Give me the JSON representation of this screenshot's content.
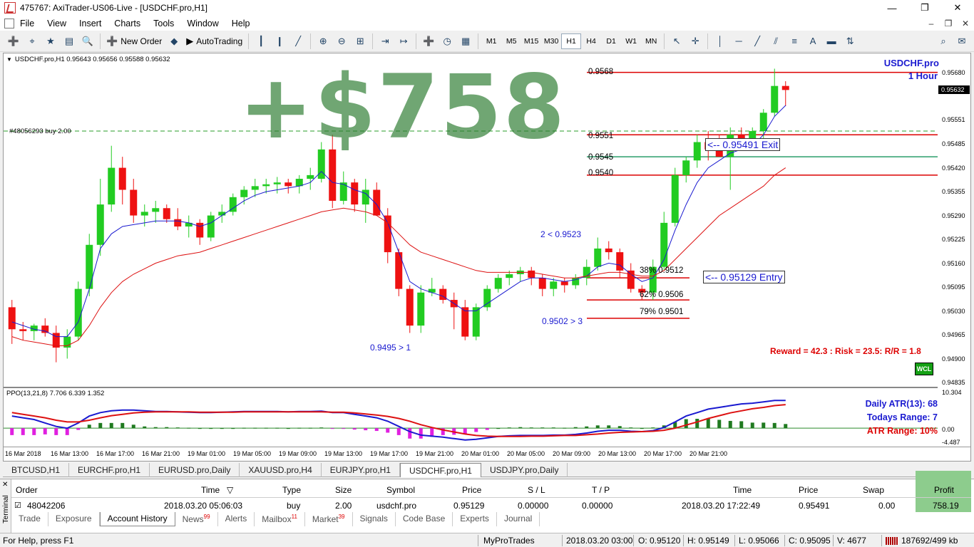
{
  "window": {
    "title": "475767: AxiTrader-US06-Live - [USDCHF.pro,H1]"
  },
  "menu": [
    "File",
    "View",
    "Insert",
    "Charts",
    "Tools",
    "Window",
    "Help"
  ],
  "toolbar": {
    "new_order": "New Order",
    "autotrading": "AutoTrading",
    "timeframes": [
      "M1",
      "M5",
      "M15",
      "M30",
      "H1",
      "H4",
      "D1",
      "W1",
      "MN"
    ],
    "active_timeframe": "H1"
  },
  "chart": {
    "header": "USDCHF.pro,H1  0.95643 0.95656 0.95588 0.95632",
    "order_line_label": "#48056293 buy 2.00",
    "pair": "USDCHF.pro",
    "timeframe_label": "1 Hour",
    "profit_overlay": "+$758",
    "price_ticks": [
      "0.95680",
      "0.95551",
      "0.95485",
      "0.95420",
      "0.95355",
      "0.95290",
      "0.95225",
      "0.95160",
      "0.95095",
      "0.95030",
      "0.94965",
      "0.94900",
      "0.94835"
    ],
    "current_price": "0.95632",
    "level_labels": {
      "l1": "0.9568",
      "l2": "0.9551",
      "l3": "0.9545",
      "l4": "0.9540",
      "fib38": "38% 0.9512",
      "fib62": "62% 0.9506",
      "fib79": "79% 0.9501"
    },
    "exit_label": "<-- 0.95491 Exit",
    "entry_label": "<-- 0.95129 Entry",
    "swing_labels": {
      "a": "2 < 0.9523",
      "b": "0.9502 > 3",
      "c": "0.9495 > 1"
    },
    "reward_risk": "Reward = 42.3 : Risk = 23.5: R/R = 1.8",
    "wcl_badge": "WCL",
    "indicator_header": "PPO(13,21,8) 7.706 6.339 1.352",
    "indicator_ticks": [
      "10.304",
      "0.00",
      "-4.487"
    ],
    "atr_daily": "Daily ATR(13): 68",
    "todays_range": "Todays Range: 7",
    "atr_range": "ATR Range: 10%",
    "time_ticks": [
      "16 Mar 2018",
      "16 Mar 13:00",
      "16 Mar 17:00",
      "16 Mar 21:00",
      "19 Mar 01:00",
      "19 Mar 05:00",
      "19 Mar 09:00",
      "19 Mar 13:00",
      "19 Mar 17:00",
      "19 Mar 21:00",
      "20 Mar 01:00",
      "20 Mar 05:00",
      "20 Mar 09:00",
      "20 Mar 13:00",
      "20 Mar 17:00",
      "20 Mar 21:00"
    ],
    "colors": {
      "bull": "#22cc22",
      "bear": "#ee1111",
      "fast_ma": "#1a1ad0",
      "slow_ma": "#dd1111"
    }
  },
  "chart_data": {
    "type": "candlestick",
    "symbol": "USDCHF.pro",
    "timeframe": "H1",
    "ylim": [
      0.94835,
      0.9572
    ],
    "candles": [
      [
        0.9504,
        0.9506,
        0.9494,
        0.9498
      ],
      [
        0.9498,
        0.95,
        0.9495,
        0.94975
      ],
      [
        0.94975,
        0.94995,
        0.9495,
        0.9499
      ],
      [
        0.9499,
        0.9501,
        0.9496,
        0.9497
      ],
      [
        0.9497,
        0.9499,
        0.9489,
        0.9493
      ],
      [
        0.9493,
        0.9498,
        0.949,
        0.9496
      ],
      [
        0.9496,
        0.9511,
        0.9495,
        0.9509
      ],
      [
        0.9509,
        0.9524,
        0.9507,
        0.9521
      ],
      [
        0.9521,
        0.9539,
        0.9518,
        0.9532
      ],
      [
        0.9532,
        0.9548,
        0.953,
        0.9542
      ],
      [
        0.9542,
        0.9545,
        0.9532,
        0.9536
      ],
      [
        0.9536,
        0.9539,
        0.9527,
        0.9529
      ],
      [
        0.9529,
        0.9532,
        0.9526,
        0.953
      ],
      [
        0.953,
        0.9533,
        0.9527,
        0.9531
      ],
      [
        0.9531,
        0.9532,
        0.9527,
        0.9528
      ],
      [
        0.9528,
        0.9531,
        0.9525,
        0.9526
      ],
      [
        0.9526,
        0.9529,
        0.9523,
        0.9527
      ],
      [
        0.9527,
        0.9528,
        0.9521,
        0.9523
      ],
      [
        0.9523,
        0.953,
        0.9522,
        0.9529
      ],
      [
        0.9529,
        0.9532,
        0.9527,
        0.953
      ],
      [
        0.953,
        0.9535,
        0.9529,
        0.9534
      ],
      [
        0.9534,
        0.9537,
        0.9532,
        0.9536
      ],
      [
        0.9536,
        0.9539,
        0.9534,
        0.9537
      ],
      [
        0.9537,
        0.9539,
        0.9535,
        0.95375
      ],
      [
        0.95375,
        0.95395,
        0.9535,
        0.9538
      ],
      [
        0.9538,
        0.9539,
        0.9535,
        0.9537
      ],
      [
        0.9537,
        0.954,
        0.9535,
        0.9539
      ],
      [
        0.9539,
        0.9542,
        0.9536,
        0.954
      ],
      [
        0.9539,
        0.9549,
        0.9538,
        0.9547
      ],
      [
        0.9547,
        0.9551,
        0.9531,
        0.9533
      ],
      [
        0.9533,
        0.9541,
        0.9532,
        0.9538
      ],
      [
        0.9538,
        0.9539,
        0.953,
        0.9532
      ],
      [
        0.9532,
        0.9539,
        0.9527,
        0.9536
      ],
      [
        0.9536,
        0.9538,
        0.9529,
        0.9529
      ],
      [
        0.9529,
        0.9531,
        0.9516,
        0.9519
      ],
      [
        0.9519,
        0.952,
        0.9507,
        0.9509
      ],
      [
        0.9509,
        0.951,
        0.9497,
        0.9499
      ],
      [
        0.9499,
        0.951,
        0.9497,
        0.9508
      ],
      [
        0.9508,
        0.9512,
        0.9507,
        0.9509
      ],
      [
        0.9509,
        0.951,
        0.9505,
        0.9506
      ],
      [
        0.9506,
        0.9508,
        0.9498,
        0.9504
      ],
      [
        0.9504,
        0.9506,
        0.9495,
        0.9496
      ],
      [
        0.9496,
        0.9505,
        0.9495,
        0.9504
      ],
      [
        0.9504,
        0.951,
        0.9503,
        0.9509
      ],
      [
        0.9509,
        0.9513,
        0.9508,
        0.9512
      ],
      [
        0.9512,
        0.9514,
        0.951,
        0.9513
      ],
      [
        0.9513,
        0.9515,
        0.9511,
        0.9514
      ],
      [
        0.9514,
        0.9515,
        0.951,
        0.9512
      ],
      [
        0.9512,
        0.9513,
        0.9507,
        0.9509
      ],
      [
        0.9509,
        0.9512,
        0.9507,
        0.9511
      ],
      [
        0.9511,
        0.9512,
        0.9508,
        0.951
      ],
      [
        0.951,
        0.9513,
        0.9509,
        0.9512
      ],
      [
        0.9512,
        0.9517,
        0.951,
        0.9515
      ],
      [
        0.9515,
        0.9523,
        0.9514,
        0.952
      ],
      [
        0.952,
        0.9522,
        0.9517,
        0.9519
      ],
      [
        0.9519,
        0.952,
        0.9512,
        0.9514
      ],
      [
        0.9514,
        0.9516,
        0.9508,
        0.9509
      ],
      [
        0.9509,
        0.951,
        0.9506,
        0.9508
      ],
      [
        0.9508,
        0.9517,
        0.9506,
        0.9515
      ],
      [
        0.9515,
        0.953,
        0.9514,
        0.9527
      ],
      [
        0.9527,
        0.9542,
        0.9526,
        0.954
      ],
      [
        0.954,
        0.9545,
        0.9538,
        0.9544
      ],
      [
        0.9544,
        0.9551,
        0.9542,
        0.9549
      ],
      [
        0.9549,
        0.9552,
        0.9544,
        0.9547
      ],
      [
        0.9547,
        0.9551,
        0.9546,
        0.9545
      ],
      [
        0.9545,
        0.9553,
        0.9536,
        0.9551
      ],
      [
        0.9551,
        0.9553,
        0.9547,
        0.9548
      ],
      [
        0.9548,
        0.9553,
        0.9547,
        0.9552
      ],
      [
        0.9552,
        0.9558,
        0.955,
        0.9557
      ],
      [
        0.9557,
        0.9569,
        0.9556,
        0.95643
      ],
      [
        0.95643,
        0.95656,
        0.95588,
        0.95632
      ]
    ],
    "series": [
      {
        "name": "fast MA",
        "values": [
          0.95,
          0.9499,
          0.9498,
          0.94975,
          0.9496,
          0.9496,
          0.95,
          0.9509,
          0.952,
          0.9524,
          0.9526,
          0.95265,
          0.9527,
          0.95275,
          0.95275,
          0.95275,
          0.9527,
          0.9526,
          0.9527,
          0.9529,
          0.9531,
          0.9533,
          0.95345,
          0.95355,
          0.9536,
          0.95365,
          0.9537,
          0.9538,
          0.9541,
          0.9538,
          0.95375,
          0.9536,
          0.9535,
          0.9532,
          0.9527,
          0.9519,
          0.9511,
          0.9509,
          0.9508,
          0.9507,
          0.9505,
          0.9503,
          0.9503,
          0.9505,
          0.9507,
          0.9509,
          0.9511,
          0.9512,
          0.9512,
          0.95115,
          0.9511,
          0.95115,
          0.95125,
          0.9515,
          0.9516,
          0.95155,
          0.9513,
          0.9511,
          0.9512,
          0.9517,
          0.9525,
          0.9532,
          0.9538,
          0.9542,
          0.9544,
          0.9546,
          0.9547,
          0.9548,
          0.9551,
          0.9556,
          0.9559
        ]
      },
      {
        "name": "slow MA",
        "values": [
          0.9496,
          0.9495,
          0.94945,
          0.9494,
          0.94935,
          0.94935,
          0.9495,
          0.9499,
          0.9504,
          0.9508,
          0.9511,
          0.9513,
          0.95145,
          0.9516,
          0.9517,
          0.9518,
          0.95185,
          0.9519,
          0.952,
          0.9521,
          0.9522,
          0.9523,
          0.9524,
          0.9525,
          0.9526,
          0.9527,
          0.9528,
          0.9529,
          0.953,
          0.95305,
          0.9531,
          0.95305,
          0.953,
          0.9529,
          0.9527,
          0.9524,
          0.9521,
          0.9519,
          0.9518,
          0.9517,
          0.9516,
          0.9515,
          0.9514,
          0.95135,
          0.95135,
          0.95135,
          0.95135,
          0.95135,
          0.9513,
          0.95125,
          0.9512,
          0.9512,
          0.95125,
          0.9513,
          0.95135,
          0.95135,
          0.9513,
          0.95125,
          0.95125,
          0.9514,
          0.9517,
          0.952,
          0.9523,
          0.9526,
          0.9529,
          0.9531,
          0.9533,
          0.9535,
          0.9537,
          0.954,
          0.9542
        ]
      }
    ],
    "levels": {
      "l1": 0.9568,
      "l2": 0.9551,
      "l3": 0.9545,
      "l4": 0.954,
      "fib38": 0.9512,
      "fib62": 0.9506,
      "fib79": 0.9501,
      "order": 0.9552
    },
    "indicator": {
      "ylim": [
        -4.487,
        10.304
      ],
      "ppo": [
        3.5,
        3.0,
        2.5,
        1.5,
        0.5,
        0.0,
        1.5,
        3.5,
        4.5,
        5.0,
        5.2,
        5.2,
        5.0,
        4.8,
        4.8,
        4.7,
        4.6,
        4.5,
        4.5,
        4.6,
        4.7,
        4.8,
        4.8,
        4.8,
        4.8,
        4.7,
        4.8,
        4.8,
        4.9,
        4.5,
        4.5,
        4.0,
        3.5,
        3.0,
        2.0,
        0.5,
        -1.0,
        -2.0,
        -2.3,
        -2.6,
        -3.0,
        -3.4,
        -3.2,
        -2.8,
        -2.4,
        -2.2,
        -2.1,
        -2.1,
        -2.1,
        -2.0,
        -2.0,
        -1.8,
        -1.4,
        -0.9,
        -0.6,
        -0.6,
        -0.9,
        -1.0,
        -0.7,
        0.2,
        1.8,
        3.5,
        4.5,
        5.5,
        6.0,
        6.5,
        7.0,
        7.2,
        7.6,
        8.0,
        8.0
      ],
      "signal": [
        4.5,
        4.0,
        3.5,
        3.0,
        2.3,
        1.8,
        1.8,
        2.3,
        3.0,
        3.6,
        4.0,
        4.4,
        4.6,
        4.7,
        4.7,
        4.7,
        4.7,
        4.6,
        4.6,
        4.6,
        4.6,
        4.7,
        4.7,
        4.7,
        4.7,
        4.7,
        4.7,
        4.7,
        4.7,
        4.6,
        4.6,
        4.4,
        4.1,
        3.8,
        3.4,
        2.8,
        2.0,
        1.0,
        0.2,
        -0.5,
        -1.1,
        -1.7,
        -2.1,
        -2.3,
        -2.4,
        -2.4,
        -2.4,
        -2.3,
        -2.3,
        -2.2,
        -2.1,
        -2.1,
        -1.9,
        -1.7,
        -1.4,
        -1.2,
        -1.1,
        -1.0,
        -0.9,
        -0.6,
        0.0,
        0.9,
        1.8,
        2.8,
        3.6,
        4.4,
        5.0,
        5.6,
        6.0,
        6.5,
        6.8
      ],
      "histogram": [
        -2.0,
        -2.0,
        -2.0,
        -1.8,
        -2.0,
        -2.0,
        -0.5,
        1.0,
        1.5,
        1.5,
        1.5,
        1.0,
        0.5,
        0.3,
        0.3,
        0.2,
        0.1,
        0.0,
        0.0,
        0.0,
        0.0,
        0.1,
        0.1,
        0.1,
        0.1,
        0.0,
        0.1,
        0.1,
        0.2,
        -0.1,
        -0.1,
        -0.4,
        -0.6,
        -0.8,
        -1.3,
        -2.0,
        -3.0,
        -3.0,
        -2.5,
        -2.0,
        -1.9,
        -1.7,
        -1.1,
        -0.5,
        0.0,
        0.2,
        0.3,
        0.2,
        0.2,
        0.2,
        0.1,
        0.3,
        0.5,
        0.8,
        0.8,
        0.6,
        0.2,
        0.0,
        0.2,
        0.8,
        1.8,
        2.6,
        2.7,
        2.7,
        2.4,
        2.1,
        2.0,
        1.6,
        1.6,
        1.5,
        1.2
      ]
    }
  },
  "symbol_tabs": [
    "BTCUSD,H1",
    "EURCHF.pro,H1",
    "EURUSD.pro,Daily",
    "XAUUSD.pro,H4",
    "EURJPY.pro,H1",
    "USDCHF.pro,H1",
    "USDJPY.pro,Daily"
  ],
  "active_symbol_tab": "USDCHF.pro,H1",
  "terminal": {
    "side_label": "Terminal",
    "columns": [
      "Order",
      "Time",
      "Type",
      "Size",
      "Symbol",
      "Price",
      "S / L",
      "T / P",
      "Time",
      "Price",
      "Swap",
      "Profit"
    ],
    "row": [
      "48042206",
      "2018.03.20 05:06:03",
      "buy",
      "2.00",
      "usdchf.pro",
      "0.95129",
      "0.00000",
      "0.00000",
      "2018.03.20 17:22:49",
      "0.95491",
      "0.00",
      "758.19"
    ],
    "tabs": [
      {
        "label": "Trade",
        "badge": ""
      },
      {
        "label": "Exposure",
        "badge": ""
      },
      {
        "label": "Account History",
        "badge": ""
      },
      {
        "label": "News",
        "badge": "99"
      },
      {
        "label": "Alerts",
        "badge": ""
      },
      {
        "label": "Mailbox",
        "badge": "11"
      },
      {
        "label": "Market",
        "badge": "39"
      },
      {
        "label": "Signals",
        "badge": ""
      },
      {
        "label": "Code Base",
        "badge": ""
      },
      {
        "label": "Experts",
        "badge": ""
      },
      {
        "label": "Journal",
        "badge": ""
      }
    ],
    "active_tab": "Account History"
  },
  "status": {
    "help": "For Help, press F1",
    "profile": "MyProTrades",
    "datetime": "2018.03.20 03:00",
    "open": "O: 0.95120",
    "high": "H: 0.95149",
    "low": "L: 0.95066",
    "close": "C: 0.95095",
    "volume": "V: 4677",
    "traffic": "187692/499 kb"
  }
}
